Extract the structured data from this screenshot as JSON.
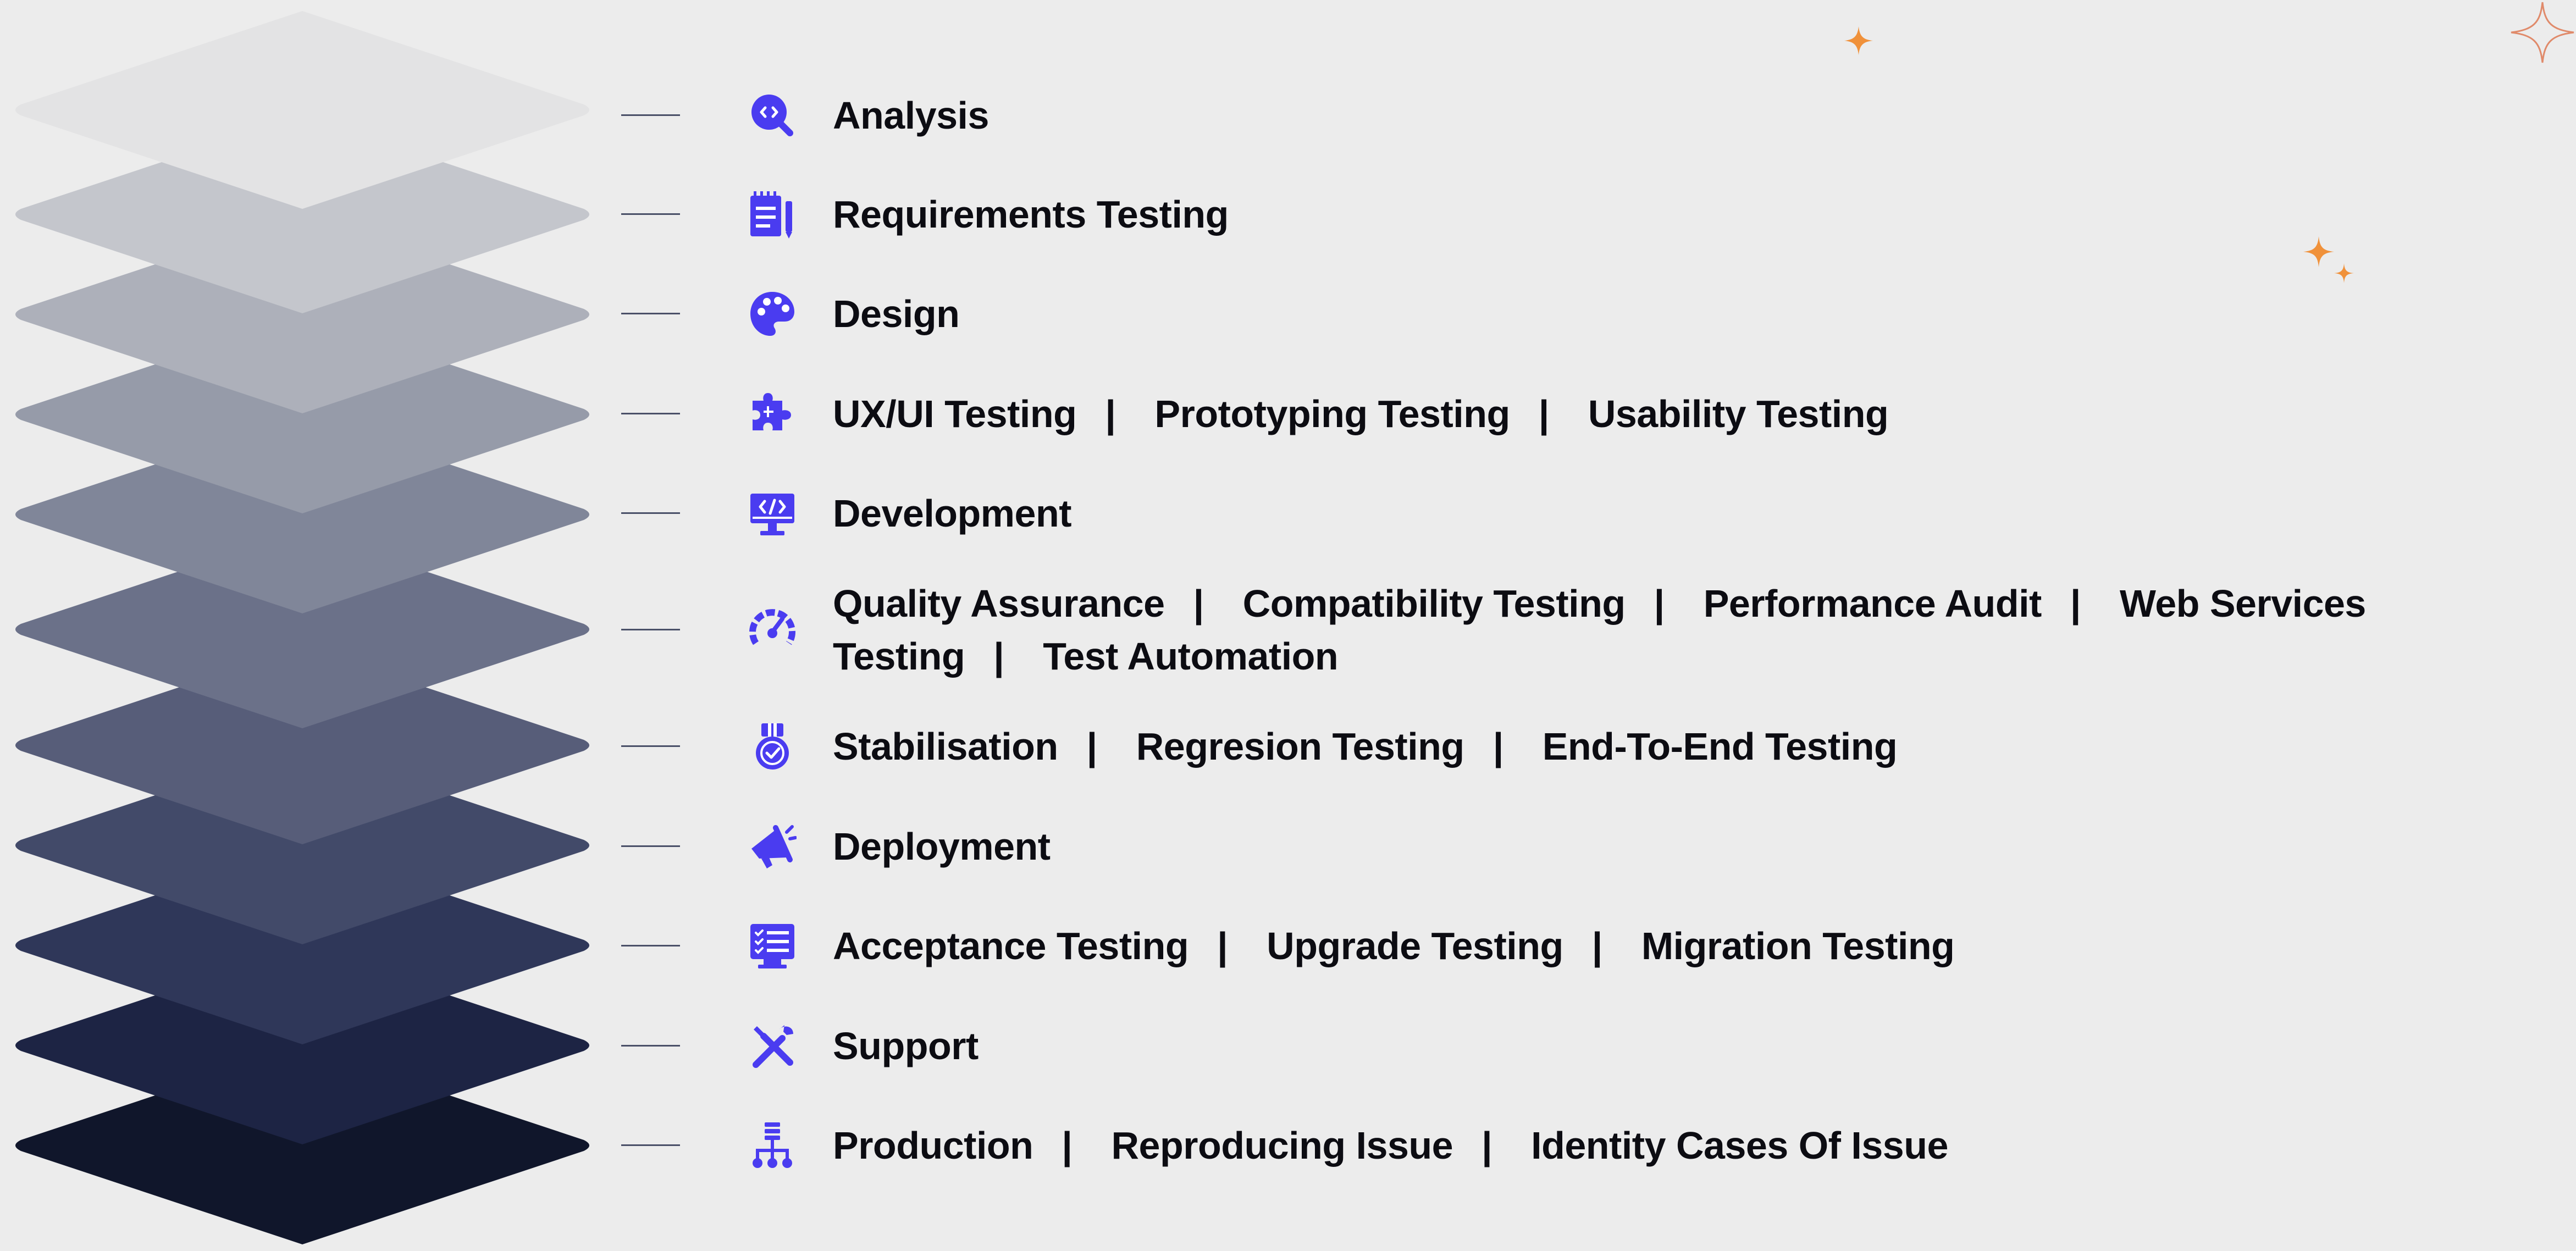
{
  "colors": {
    "background": "#ececec",
    "icon": "#4a3cf0",
    "text": "#0c0c12",
    "sparkle": "#f0913a",
    "layers": [
      "#e3e3e4",
      "#c4c6cc",
      "#adb0ba",
      "#969ba9",
      "#808699",
      "#6b7189",
      "#575d79",
      "#424a69",
      "#2f3759",
      "#1d2444",
      "#10162b"
    ]
  },
  "separator": "|",
  "stages": [
    {
      "icon": "code-search-icon",
      "labels": [
        "Analysis"
      ]
    },
    {
      "icon": "notepad-pen-icon",
      "labels": [
        "Requirements Testing"
      ]
    },
    {
      "icon": "palette-icon",
      "labels": [
        "Design"
      ]
    },
    {
      "icon": "puzzle-icon",
      "labels": [
        "UX/UI Testing",
        "Prototyping Testing",
        "Usability Testing"
      ]
    },
    {
      "icon": "monitor-code-icon",
      "labels": [
        "Development"
      ]
    },
    {
      "icon": "gauge-icon",
      "labels": [
        "Quality Assurance",
        "Compatibility Testing",
        "Performance Audit",
        "Web Services Testing",
        "Test Automation"
      ]
    },
    {
      "icon": "medal-icon",
      "labels": [
        "Stabilisation",
        "Regresion Testing",
        "End-To-End Testing"
      ]
    },
    {
      "icon": "megaphone-icon",
      "labels": [
        "Deployment"
      ]
    },
    {
      "icon": "checklist-monitor-icon",
      "labels": [
        "Acceptance Testing",
        "Upgrade Testing",
        "Migration Testing"
      ]
    },
    {
      "icon": "tools-icon",
      "labels": [
        "Support"
      ]
    },
    {
      "icon": "hierarchy-icon",
      "labels": [
        "Production",
        "Reproducing Issue",
        "Identity Cases Of Issue"
      ]
    }
  ]
}
